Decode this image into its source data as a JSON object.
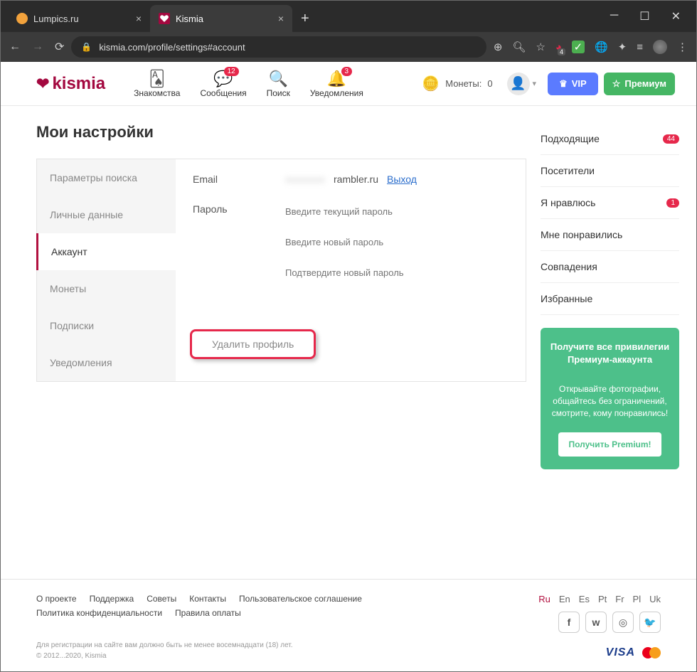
{
  "browser": {
    "tabs": [
      {
        "title": "Lumpics.ru",
        "favicon_color": "#f2a23c"
      },
      {
        "title": "Kismia",
        "favicon_color": "#a3083f",
        "active": true
      }
    ],
    "url": "kismia.com/profile/settings#account",
    "ext_badge": "4"
  },
  "header": {
    "logo": "kismia",
    "nav": [
      {
        "label": "Знакомства"
      },
      {
        "label": "Сообщения",
        "badge": "12"
      },
      {
        "label": "Поиск"
      },
      {
        "label": "Уведомления",
        "badge": "3"
      }
    ],
    "coins_label": "Монеты:",
    "coins_value": "0",
    "vip_label": "VIP",
    "premium_label": "Премиум"
  },
  "page_title": "Мои настройки",
  "side_tabs": [
    "Параметры поиска",
    "Личные данные",
    "Аккаунт",
    "Монеты",
    "Подписки",
    "Уведомления"
  ],
  "form": {
    "email_label": "Email",
    "email_value": "rambler.ru",
    "logout": "Выход",
    "password_label": "Пароль",
    "pw_current": "Введите текущий пароль",
    "pw_new": "Введите новый пароль",
    "pw_confirm": "Подтвердите новый пароль",
    "delete": "Удалить профиль"
  },
  "sidebar": {
    "links": [
      {
        "label": "Подходящие",
        "badge": "44"
      },
      {
        "label": "Посетители"
      },
      {
        "label": "Я нравлюсь",
        "badge": "1"
      },
      {
        "label": "Мне понравились"
      },
      {
        "label": "Совпадения"
      },
      {
        "label": "Избранные"
      }
    ],
    "promo": {
      "line1": "Получите все привилегии Премиум-аккаунта",
      "line2": "Открывайте фотографии, общайтесь без ограничений, смотрите, кому понравились!",
      "btn": "Получить Premium!"
    }
  },
  "footer": {
    "links": [
      "О проекте",
      "Поддержка",
      "Советы",
      "Контакты",
      "Пользовательское соглашение",
      "Политика конфиденциальности",
      "Правила оплаты"
    ],
    "langs": [
      "Ru",
      "En",
      "Es",
      "Pt",
      "Fr",
      "Pl",
      "Uk"
    ],
    "fine1": "Для регистрации на сайте вам должно быть не менее восемнадцати (18) лет.",
    "fine2": "© 2012...2020, Kismia",
    "visa": "VISA"
  }
}
